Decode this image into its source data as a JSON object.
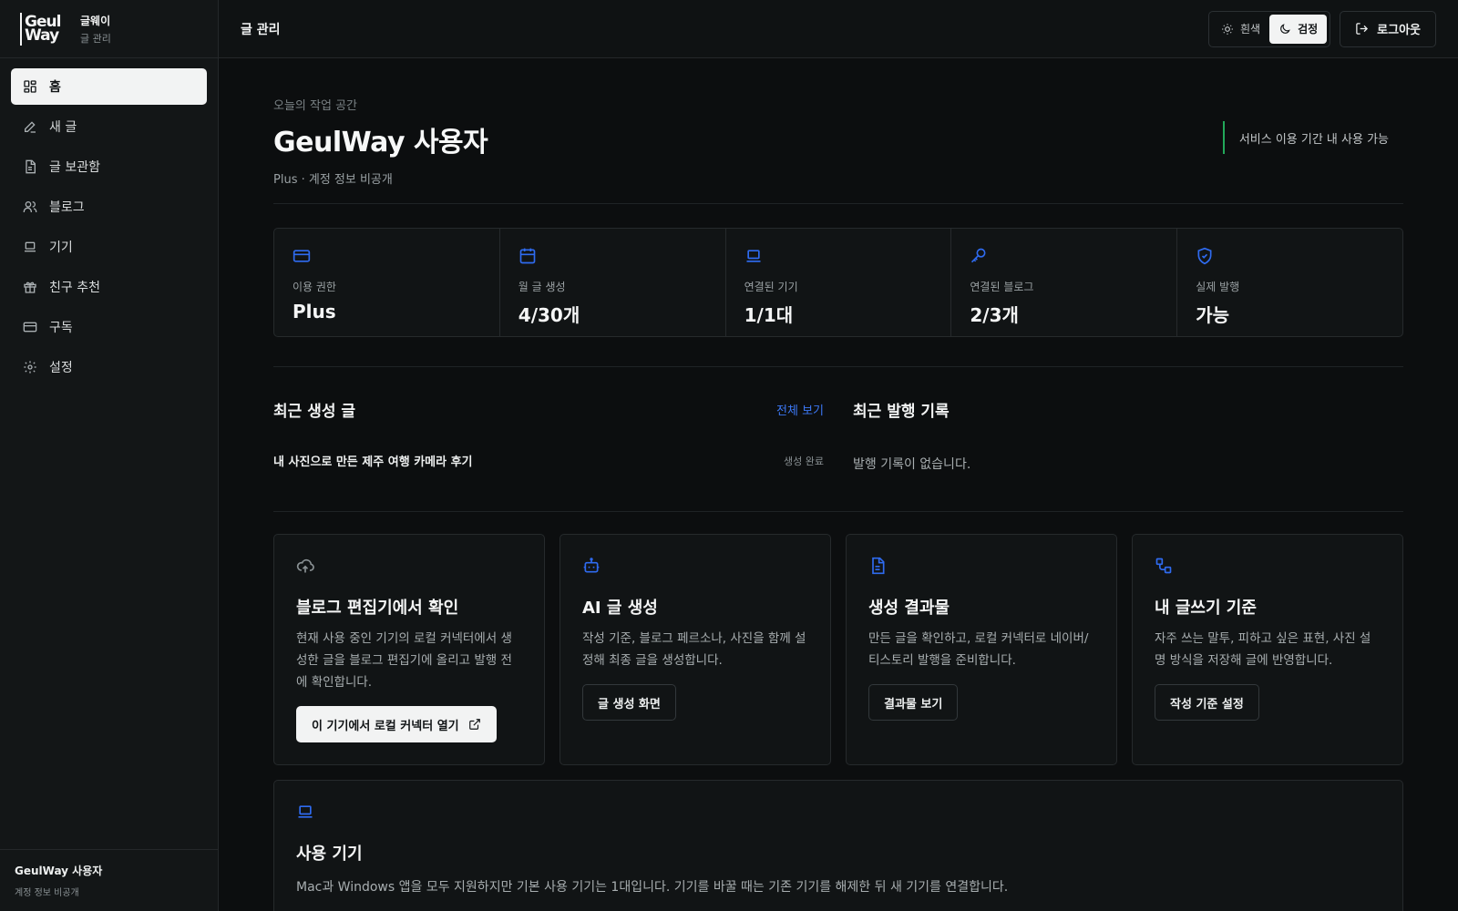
{
  "brand": {
    "logo_line1": "Geul",
    "logo_line2": "Way",
    "name": "글웨이",
    "subtitle": "글 관리"
  },
  "sidebar": {
    "items": [
      {
        "label": "홈",
        "icon": "dashboard-icon"
      },
      {
        "label": "새 글",
        "icon": "pencil-icon"
      },
      {
        "label": "글 보관함",
        "icon": "document-icon"
      },
      {
        "label": "블로그",
        "icon": "users-icon"
      },
      {
        "label": "기기",
        "icon": "laptop-icon"
      },
      {
        "label": "친구 추천",
        "icon": "gift-icon"
      },
      {
        "label": "구독",
        "icon": "credit-card-icon"
      },
      {
        "label": "설정",
        "icon": "gear-icon"
      }
    ],
    "active_index": 0,
    "footer": {
      "user": "GeulWay 사용자",
      "status": "계정 정보 비공개"
    }
  },
  "header": {
    "title": "글 관리",
    "theme": {
      "light_label": "흰색",
      "dark_label": "검정",
      "selected": "dark"
    },
    "logout_label": "로그아웃"
  },
  "hero": {
    "eyebrow": "오늘의 작업 공간",
    "title": "GeulWay 사용자",
    "meta": "Plus · 계정 정보 비공개",
    "note": "서비스 이용 기간 내 사용 가능"
  },
  "stats": [
    {
      "icon": "credit-card-icon",
      "label": "이용 권한",
      "value": "Plus"
    },
    {
      "icon": "calendar-icon",
      "label": "월 글 생성",
      "value": "4/30개"
    },
    {
      "icon": "laptop-icon",
      "label": "연결된 기기",
      "value": "1/1대"
    },
    {
      "icon": "key-icon",
      "label": "연결된 블로그",
      "value": "2/3개"
    },
    {
      "icon": "shield-check-icon",
      "label": "실제 발행",
      "value": "가능"
    }
  ],
  "recent_posts": {
    "title": "최근 생성 글",
    "view_all": "전체 보기",
    "items": [
      {
        "title": "내 사진으로 만든 제주 여행 카메라 후기",
        "status": "생성 완료"
      }
    ]
  },
  "recent_publish": {
    "title": "최근 발행 기록",
    "empty": "발행 기록이 없습니다."
  },
  "cards": [
    {
      "icon": "cloud-upload-icon",
      "title": "블로그 편집기에서 확인",
      "desc": "현재 사용 중인 기기의 로컬 커넥터에서 생성한 글을 블로그 편집기에 올리고 발행 전에 확인합니다.",
      "button": "이 기기에서 로컬 커넥터 열기"
    },
    {
      "icon": "robot-icon",
      "title": "AI 글 생성",
      "desc": "작성 기준, 블로그 페르소나, 사진을 함께 설정해 최종 글을 생성합니다.",
      "button": "글 생성 화면"
    },
    {
      "icon": "document-icon",
      "title": "생성 결과물",
      "desc": "만든 글을 확인하고, 로컬 커넥터로 네이버/티스토리 발행을 준비합니다.",
      "button": "결과물 보기"
    },
    {
      "icon": "workflow-icon",
      "title": "내 글쓰기 기준",
      "desc": "자주 쓰는 말투, 피하고 싶은 표현, 사진 설명 방식을 저장해 글에 반영합니다.",
      "button": "작성 기준 설정"
    }
  ],
  "device": {
    "icon": "laptop-icon",
    "title": "사용 기기",
    "desc": "Mac과 Windows 앱을 모두 지원하지만 기본 사용 기기는 1대입니다. 기기를 바꿀 때는 기존 기기를 해제한 뒤 새 기기를 연결합니다."
  },
  "colors": {
    "accent_blue": "#2f6bf0",
    "link_blue": "#3d78f5",
    "note_green": "#22a85a",
    "background": "#0c0e0f"
  }
}
